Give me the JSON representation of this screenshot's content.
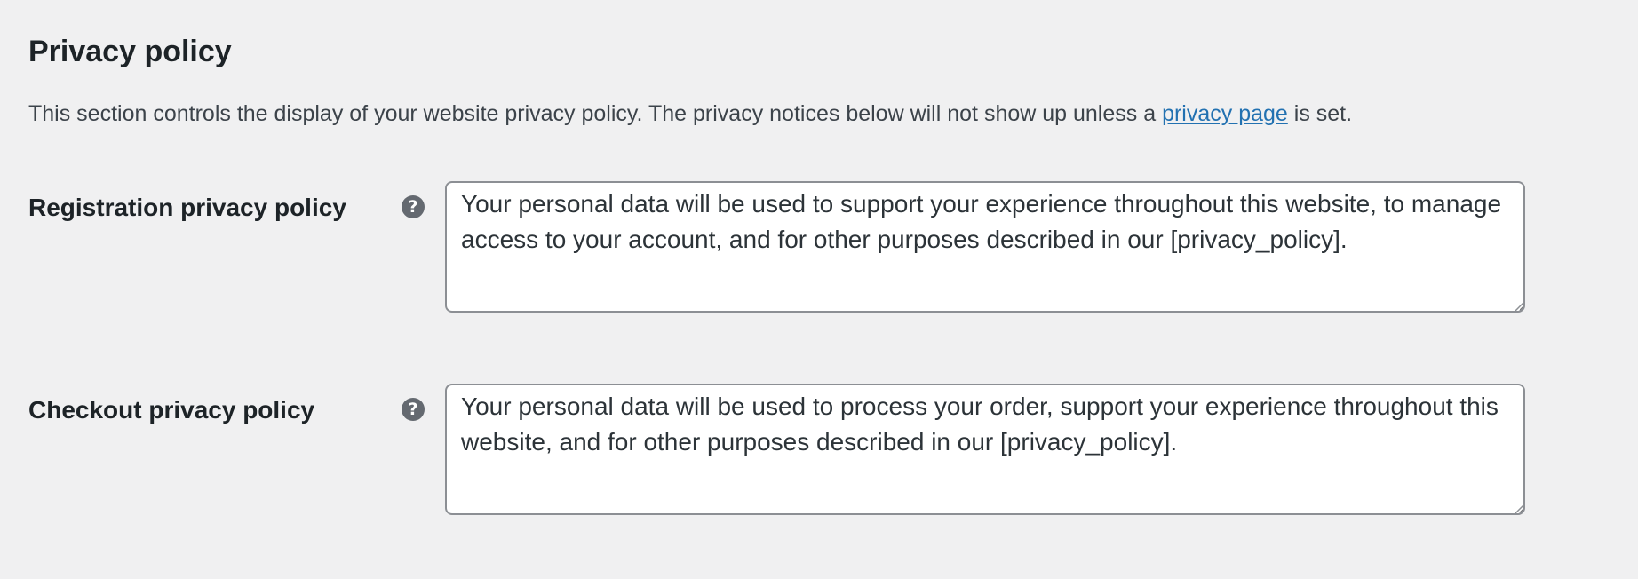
{
  "section": {
    "title": "Privacy policy",
    "description_prefix": "This section controls the display of your website privacy policy. The privacy notices below will not show up unless a ",
    "description_link": "privacy page",
    "description_suffix": " is set."
  },
  "fields": [
    {
      "label": "Registration privacy policy",
      "help_icon": "question-circle-icon",
      "value": "Your personal data will be used to support your experience throughout this website, to manage access to your account, and for other purposes described in our [privacy_policy]."
    },
    {
      "label": "Checkout privacy policy",
      "help_icon": "question-circle-icon",
      "value": "Your personal data will be used to process your order, support your experience throughout this website, and for other purposes described in our [privacy_policy]."
    }
  ],
  "colors": {
    "background": "#f0f0f1",
    "text": "#1d2327",
    "link": "#2271b1",
    "help_icon": "#646970",
    "textarea_border": "#8c8f94"
  }
}
